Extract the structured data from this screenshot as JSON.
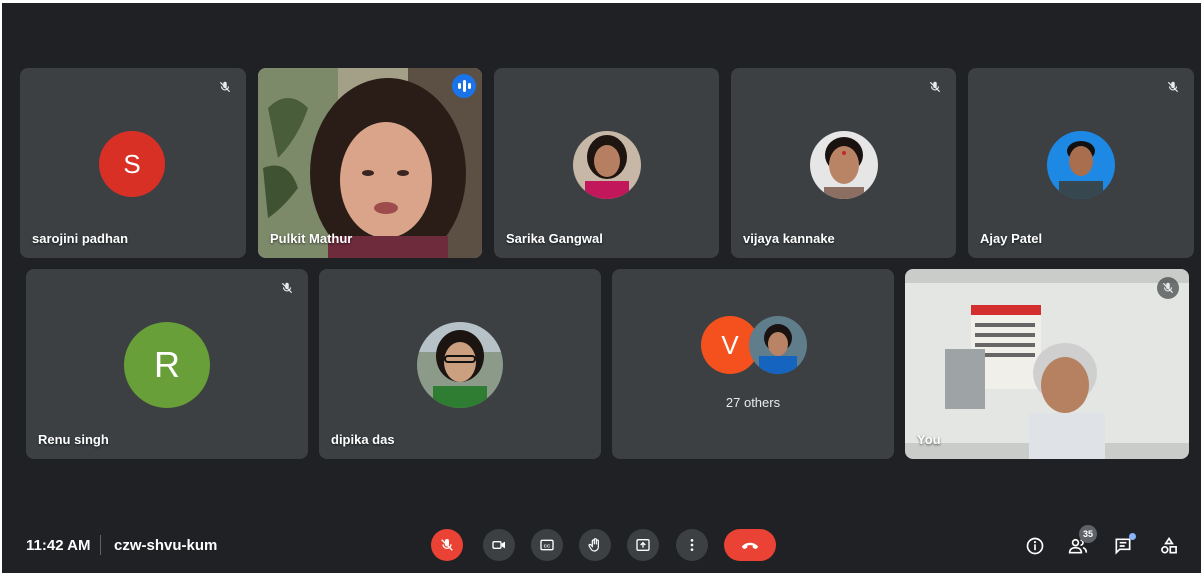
{
  "participants_row1": [
    {
      "name": "sarojini padhan",
      "initial": "S",
      "avatar_color": "#d93025",
      "muted": true
    },
    {
      "name": "Pulkit Mathur",
      "speaking": true
    },
    {
      "name": "Sarika Gangwal",
      "muted": false
    },
    {
      "name": "vijaya kannake",
      "muted": true
    },
    {
      "name": "Ajay Patel",
      "muted": true
    }
  ],
  "participants_row2": [
    {
      "name": "Renu singh",
      "initial": "R",
      "avatar_color": "#689f38",
      "muted": true
    },
    {
      "name": "dipika das",
      "muted": false
    },
    {
      "others_initial": "V",
      "others_color": "#f4511e",
      "others_label": "27 others"
    },
    {
      "name": "You",
      "muted": true
    }
  ],
  "meeting": {
    "time": "11:42 AM",
    "code": "czw-shvu-kum",
    "participant_count": "35"
  },
  "controls": {
    "mic": "mic-off-icon",
    "camera": "camera-icon",
    "captions": "captions-icon",
    "raise_hand": "hand-icon",
    "present": "present-icon",
    "more": "more-icon",
    "leave": "end-call-icon"
  },
  "colors": {
    "background": "#202124",
    "tile": "#3c4043",
    "accent": "#8ab4f8",
    "danger": "#ea4335"
  }
}
